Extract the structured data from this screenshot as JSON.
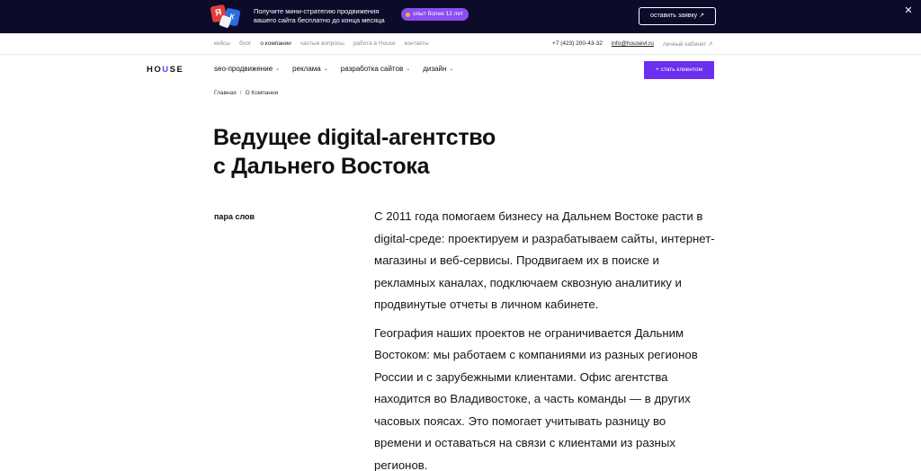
{
  "promo": {
    "logo_letters": [
      "Я",
      "К"
    ],
    "text_line1": "Получите мини-стратегию продвижения",
    "text_line2": "вашего сайта бесплатно до конца месяца",
    "badge": "опыт более 12 лет",
    "cta": "оставить заявку ↗",
    "close": "✕"
  },
  "toplinks": [
    "кейсы",
    "блог",
    "о компании",
    "частые вопросы",
    "работа в House",
    "контакты"
  ],
  "contacts": {
    "phone": "+7 (423) 200-43-32",
    "email": "info@housevl.ru",
    "cabinet": "личный кабинет ↗"
  },
  "nav": {
    "brand_pre": "HO",
    "brand_accent": "U",
    "brand_post": "SE",
    "items": [
      "seo-продвижение",
      "реклама",
      "разработка сайтов",
      "дизайн"
    ],
    "chevron": "⌄",
    "client_button": "+ стать клиентом"
  },
  "breadcrumb": [
    "Главная",
    "/",
    "О Компании"
  ],
  "page": {
    "title_line1": "Ведущее digital-агентство",
    "title_line2": "с Дальнего Востока",
    "side_label": "пара слов",
    "paragraph1": "С 2011 года помогаем бизнесу на Дальнем Востоке расти в digital-среде: проектируем и разрабатываем сайты, интернет-магазины и веб-сервисы. Продвигаем их в поиске и рекламных каналах, подключаем сквозную аналитику и продвинутые отчеты в личном кабинете.",
    "paragraph2": "География наших проектов не ограничивается Дальним Востоком: мы работаем с компаниями из разных регионов России и с зарубежными клиентами. Офис агентства находится во Владивостоке, а часть команды — в других часовых поясах. Это помогает учитывать разницу во времени и оставаться на связи с клиентами из разных регионов."
  },
  "colors": {
    "banner_bg": "#0c0b2a",
    "accent": "#6b2ff0",
    "badge": "#8b4ef0"
  }
}
